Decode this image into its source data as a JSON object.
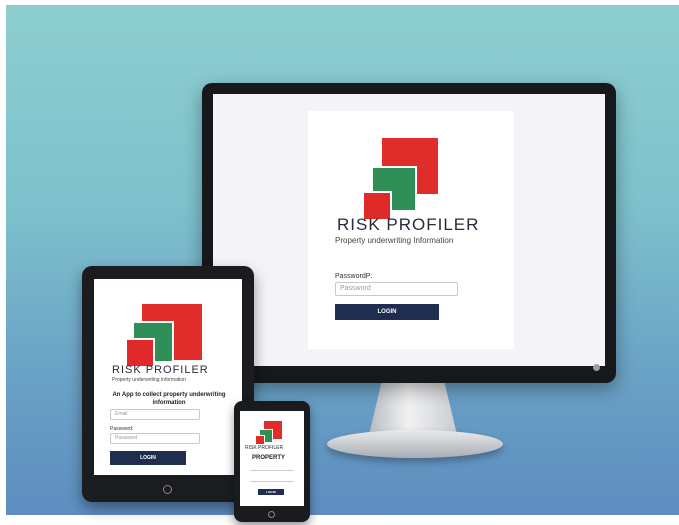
{
  "monitor": {
    "brand": "RISK PROFILER",
    "tagline": "Property underwriting Information",
    "password_label": "PasswordP:",
    "password_placeholder": "Password",
    "login_label": "LOGIN"
  },
  "tablet": {
    "brand": "RISK PROFILER",
    "tagline": "Property underwriting Information",
    "heading": "An App to collect property underwriting information",
    "email_placeholder": "Email",
    "password_label": "Password:",
    "password_placeholder": "Password",
    "login_label": "LOGIN"
  },
  "phone": {
    "brand": "RISK PROFILER",
    "heading": "PROPERTY",
    "login_label": "LOGIN"
  },
  "colors": {
    "logo_red": "#e12c2c",
    "logo_green": "#2f8f57",
    "button_navy": "#1f2d4f"
  }
}
